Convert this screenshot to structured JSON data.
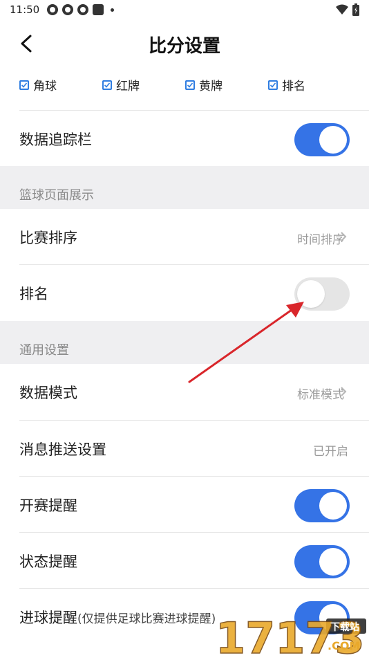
{
  "status_bar": {
    "time": "11:50"
  },
  "header": {
    "title": "比分设置"
  },
  "checkboxes": [
    {
      "label": "角球",
      "checked": true
    },
    {
      "label": "红牌",
      "checked": true
    },
    {
      "label": "黄牌",
      "checked": true
    },
    {
      "label": "排名",
      "checked": true
    }
  ],
  "rows": {
    "data_tracker": {
      "label": "数据追踪栏",
      "on": true
    },
    "match_sort": {
      "label": "比赛排序",
      "value": "时间排序"
    },
    "ranking": {
      "label": "排名",
      "on": false
    },
    "data_mode": {
      "label": "数据模式",
      "value": "标准模式"
    },
    "push_settings": {
      "label": "消息推送设置",
      "value": "已开启"
    },
    "start_reminder": {
      "label": "开赛提醒",
      "on": true
    },
    "status_reminder": {
      "label": "状态提醒",
      "on": true
    },
    "goal_reminder": {
      "label": "进球提醒",
      "note": "(仅提供足球比赛进球提醒)",
      "on": true
    }
  },
  "sections": {
    "basketball": "篮球页面展示",
    "general": "通用设置"
  },
  "watermark": {
    "text": "17173",
    "badge": "下载站",
    "domain": ".COM"
  },
  "colors": {
    "accent": "#3573e6",
    "annotation_arrow": "#d9262b"
  }
}
